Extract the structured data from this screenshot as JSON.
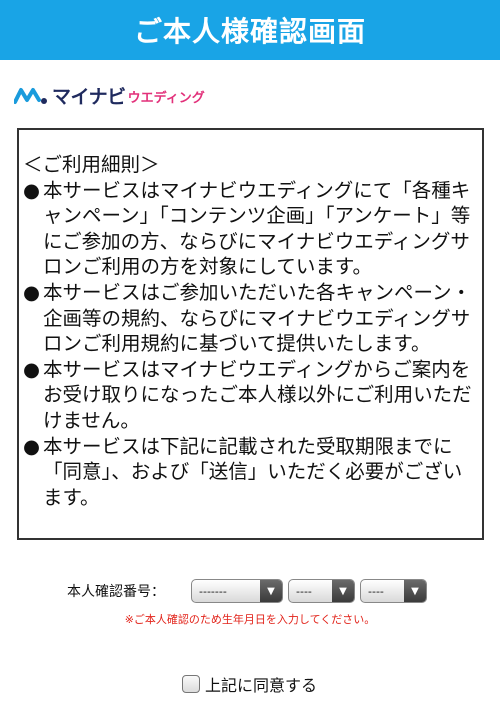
{
  "header": {
    "title": "ご本人様確認画面"
  },
  "logo": {
    "main": "マイナビ",
    "sub": "ウエディング"
  },
  "terms": {
    "heading": "＜ご利用細則＞",
    "bullet": "●",
    "items": [
      "本サービスはマイナビウエディングにて「各種キャンペーン」「コンテンツ企画」「アンケート」等にご参加の方、ならびにマイナビウエディングサロンご利用の方を対象にしています。",
      "本サービスはご参加いただいた各キャンペーン・企画等の規約、ならびにマイナビウエディングサロンご利用規約に基づいて提供いたします。",
      "本サービスはマイナビウエディングからご案内をお受け取りになったご本人様以外にご利用いただけません。",
      "本サービスは下記に記載された受取期限までに「同意」、および「送信」いただく必要がございます。"
    ]
  },
  "pin": {
    "label": "本人確認番号：",
    "year": "-------",
    "month": "----",
    "day": "----"
  },
  "note": "※ご本人確認のため生年月日を入力してください。",
  "agree": {
    "label": "上記に同意する",
    "checked": false
  }
}
